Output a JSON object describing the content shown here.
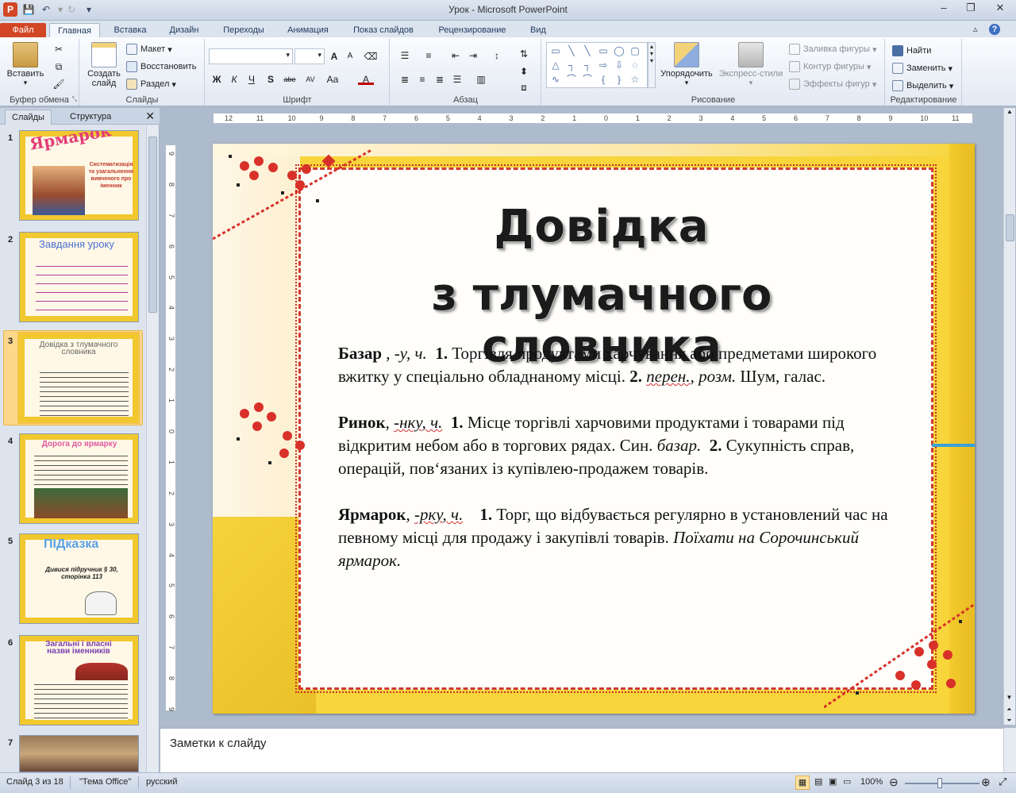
{
  "window": {
    "title": "Урок  -  Microsoft PowerPoint",
    "app_icon": "P",
    "controls": [
      "–",
      "❐",
      "✕"
    ]
  },
  "ribbon_tabs": [
    {
      "label": "Файл"
    },
    {
      "label": "Главная"
    },
    {
      "label": "Вставка"
    },
    {
      "label": "Дизайн"
    },
    {
      "label": "Переходы"
    },
    {
      "label": "Анимация"
    },
    {
      "label": "Показ слайдов"
    },
    {
      "label": "Рецензирование"
    },
    {
      "label": "Вид"
    }
  ],
  "ribbon": {
    "clipboard": {
      "paste": "Вставить",
      "label": "Буфер обмена"
    },
    "slides": {
      "new_slide_line1": "Создать",
      "new_slide_line2": "слайд",
      "layout": "Макет",
      "reset": "Восстановить",
      "section": "Раздел",
      "label": "Слайды"
    },
    "font": {
      "label": "Шрифт",
      "bold": "Ж",
      "italic": "К",
      "underline": "Ч",
      "strike": "S",
      "shadow": "abe",
      "spacing": "AV",
      "case": "Aa",
      "grow": "A",
      "shrink": "A"
    },
    "paragraph": {
      "label": "Абзац"
    },
    "drawing": {
      "arrange": "Упорядочить",
      "quick_styles": "Экспресс-стили",
      "fill": "Заливка фигуры",
      "outline": "Контур фигуры",
      "effects": "Эффекты фигур",
      "label": "Рисование"
    },
    "editing": {
      "find": "Найти",
      "replace": "Заменить",
      "select": "Выделить",
      "label": "Редактирование"
    }
  },
  "left_panel": {
    "tab_slides": "Слайды",
    "tab_outline": "Структура",
    "thumbnails": [
      {
        "num": "1",
        "title": "Ярмарок",
        "sub": "Систематизація та узагальнення вивченого про іменник"
      },
      {
        "num": "2",
        "title": "Завдання уроку"
      },
      {
        "num": "3",
        "title": "Довідка з тлумачного словника"
      },
      {
        "num": "4",
        "title": "Дорога до ярмарку"
      },
      {
        "num": "5",
        "title": "ПІДказка",
        "sub": "Дивися підручник § 30, сторінка 113"
      },
      {
        "num": "6",
        "title": "Загальні і власні назви іменників"
      },
      {
        "num": "7"
      }
    ]
  },
  "ruler": {
    "h_ticks": [
      "12",
      "11",
      "10",
      "9",
      "8",
      "7",
      "6",
      "5",
      "4",
      "3",
      "2",
      "1",
      "0",
      "1",
      "2",
      "3",
      "4",
      "5",
      "6",
      "7",
      "8",
      "9",
      "10",
      "11",
      "12"
    ],
    "v_ticks": [
      "9",
      "8",
      "7",
      "6",
      "5",
      "4",
      "3",
      "2",
      "1",
      "0",
      "1",
      "2",
      "3",
      "4",
      "5",
      "6",
      "7",
      "8",
      "9"
    ]
  },
  "slide": {
    "title_line1": "Довідка",
    "title_line2": "з тлумачного словника",
    "entries": [
      {
        "word": "Базар",
        "gram_plain": " , ",
        "gram": "-у, ч.",
        "n1": "1.",
        "def1": " Торгівля продуктами харчування або предметами широкого вжитку у спеціально обладнаному місці. ",
        "n2": "2.",
        "def2_italic_a": "перен.",
        "def2_italic_b": ", розм.",
        "def2": " Шум, галас."
      },
      {
        "word": "Ринок",
        "gram_plain": ", ",
        "gram": "-нку, ч.",
        "n1": "1.",
        "def1": " Місце торгівлі харчовими продуктами і товарами під відкритим небом або в торгових рядах. Син. ",
        "syn": "базар.",
        "n2": "2.",
        "def2": " Сукупність справ, операцій, пов‘язаних із купівлею-продажем товарів."
      },
      {
        "word": "Ярмарок",
        "gram_plain": ", ",
        "gram": "-рку, ч.",
        "n1": "1.",
        "def1": " Торг, що відбувається регулярно в установлений час на певному місці для продажу і закупівлі товарів.  ",
        "example": "Поїхати на Сорочинський ярмарок."
      }
    ]
  },
  "notes": {
    "placeholder": "Заметки к слайду"
  },
  "status": {
    "slide_of": "Слайд 3 из 18",
    "theme": "\"Тема Office\"",
    "language": "русский",
    "zoom": "100%"
  }
}
